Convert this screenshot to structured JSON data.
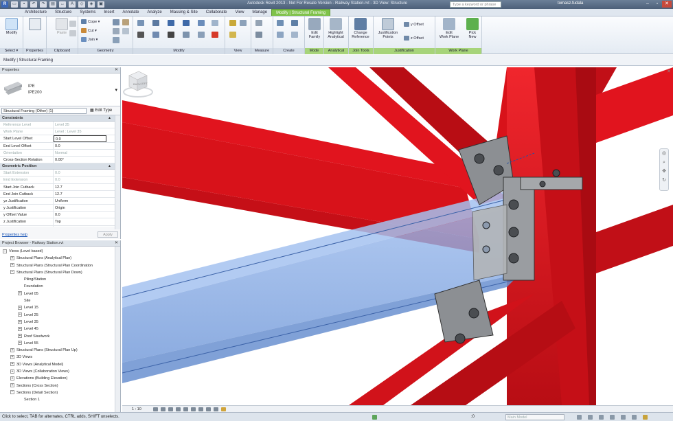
{
  "titlebar": {
    "title": "Autodesk Revit 2013 - Not For Resale Version -   Railway Station.rvt - 3D View: Structure",
    "search_placeholder": "Type a keyword or phrase",
    "user": "tomasz.fudala",
    "qat_icons": [
      "revit-logo-icon",
      "open-icon",
      "save-icon",
      "undo-icon",
      "redo-icon",
      "print-icon",
      "measure-icon",
      "text-icon",
      "3d-view-icon",
      "section-icon",
      "close-hidden-icon"
    ],
    "revit_letter": "R"
  },
  "tabs": [
    "Architecture",
    "Structure",
    "Systems",
    "Insert",
    "Annotate",
    "Analyze",
    "Massing & Site",
    "Collaborate",
    "View",
    "Manage",
    "Modify | Structural Framing"
  ],
  "ribbon": {
    "select": {
      "button": "Modify",
      "label": "Select ▾"
    },
    "properties": {
      "label": "Properties"
    },
    "clipboard": {
      "paste": "Paste",
      "label": "Clipboard"
    },
    "geometry": {
      "cope": "Cope ▾",
      "cut": "Cut ▾",
      "join": "Join ▾",
      "label": "Geometry"
    },
    "modify": {
      "label": "Modify"
    },
    "view": {
      "label": "View"
    },
    "measure": {
      "label": "Measure"
    },
    "create": {
      "label": "Create"
    },
    "mode": {
      "button": "Edit\nFamily",
      "label": "Mode"
    },
    "analytical": {
      "button": "Highlight\nAnalytical",
      "label": "Analytical"
    },
    "jointools": {
      "button": "Change\nReference",
      "label": "Join Tools"
    },
    "justification": {
      "button": "Justification\nPoints",
      "y_offset": "y Offset",
      "z_offset": "z Offset",
      "label": "Justification"
    },
    "workplane": {
      "edit": "Edit\nWork Plane",
      "pick": "Pick\nNew",
      "label": "Work Plane"
    }
  },
  "options_bar": {
    "text": "Modify | Structural Framing"
  },
  "properties": {
    "header": "Properties",
    "type_name": "IPE",
    "type_size": "IPE200",
    "filter": "Structural Framing (Other) (1)",
    "edit_type": "Edit Type",
    "groups": [
      {
        "name": "Constraints",
        "rows": [
          {
            "k": "Reference Level",
            "v": "Level 35",
            "dis": true
          },
          {
            "k": "Work Plane",
            "v": "Level : Level 35",
            "dis": true
          },
          {
            "k": "Start Level Offset",
            "v": "0.0",
            "sel": true
          },
          {
            "k": "End Level Offset",
            "v": "0.0"
          },
          {
            "k": "Orientation",
            "v": "Normal",
            "dis": true
          },
          {
            "k": "Cross-Section Rotation",
            "v": "0.00°"
          }
        ]
      },
      {
        "name": "Geometric Position",
        "rows": [
          {
            "k": "Start Extension",
            "v": "0.0",
            "dis": true
          },
          {
            "k": "End Extension",
            "v": "0.0",
            "dis": true
          },
          {
            "k": "Start Join Cutback",
            "v": "12.7"
          },
          {
            "k": "End Join Cutback",
            "v": "12.7"
          },
          {
            "k": "yz Justification",
            "v": "Uniform"
          },
          {
            "k": "y Justification",
            "v": "Origin"
          },
          {
            "k": "y Offset Value",
            "v": "0.0"
          },
          {
            "k": "z Justification",
            "v": "Top"
          },
          {
            "k": "z Offset Value",
            "v": "0.0"
          }
        ]
      }
    ],
    "help": "Properties help",
    "apply": "Apply"
  },
  "browser": {
    "header": "Project Browser - Railway Station.rvt",
    "items": [
      {
        "t": "Views (Level based)",
        "lvl": 0,
        "ex": "−"
      },
      {
        "t": "Structural Plans (Analytical Plan)",
        "lvl": 1,
        "ex": "+"
      },
      {
        "t": "Structural Plans (Structural Plan Coordination",
        "lvl": 1,
        "ex": "+"
      },
      {
        "t": "Structural Plans (Structural Plan Down)",
        "lvl": 1,
        "ex": "−"
      },
      {
        "t": "Piling/Station",
        "lvl": 2,
        "ex": ""
      },
      {
        "t": "Foundation",
        "lvl": 2,
        "ex": ""
      },
      {
        "t": "Level 05",
        "lvl": 2,
        "ex": "+"
      },
      {
        "t": "Site",
        "lvl": 2,
        "ex": ""
      },
      {
        "t": "Level 15",
        "lvl": 2,
        "ex": "+"
      },
      {
        "t": "Level 25",
        "lvl": 2,
        "ex": "+"
      },
      {
        "t": "Level 35",
        "lvl": 2,
        "ex": "+"
      },
      {
        "t": "Level 45",
        "lvl": 2,
        "ex": "+"
      },
      {
        "t": "Roof Steelwork",
        "lvl": 2,
        "ex": "+"
      },
      {
        "t": "Level 55",
        "lvl": 2,
        "ex": "+"
      },
      {
        "t": "Structural Plans (Structural Plan Up)",
        "lvl": 1,
        "ex": "+"
      },
      {
        "t": "3D Views",
        "lvl": 1,
        "ex": "+"
      },
      {
        "t": "3D Views (Analytical Model)",
        "lvl": 1,
        "ex": "+"
      },
      {
        "t": "3D Views (Collaboration Views)",
        "lvl": 1,
        "ex": "+"
      },
      {
        "t": "Elevations (Building Elevation)",
        "lvl": 1,
        "ex": "+"
      },
      {
        "t": "Sections (Cross Section)",
        "lvl": 1,
        "ex": "+"
      },
      {
        "t": "Sections (Detail Section)",
        "lvl": 1,
        "ex": "−"
      },
      {
        "t": "Section 1",
        "lvl": 2,
        "ex": ""
      }
    ]
  },
  "viewcube": {
    "front": "BACK",
    "right": "LEFT"
  },
  "view_control": {
    "scale": "1 : 10"
  },
  "status": {
    "text": "Click to select, TAB for alternates, CTRL adds, SHIFT unselects.",
    "zero": ":0",
    "model": "Main Model"
  },
  "colors": {
    "steel_red": "#e1141e",
    "selected_blue": "#7aa6e6",
    "ribbon_green": "#7fc24a",
    "plate_grey": "#8c8f93"
  }
}
